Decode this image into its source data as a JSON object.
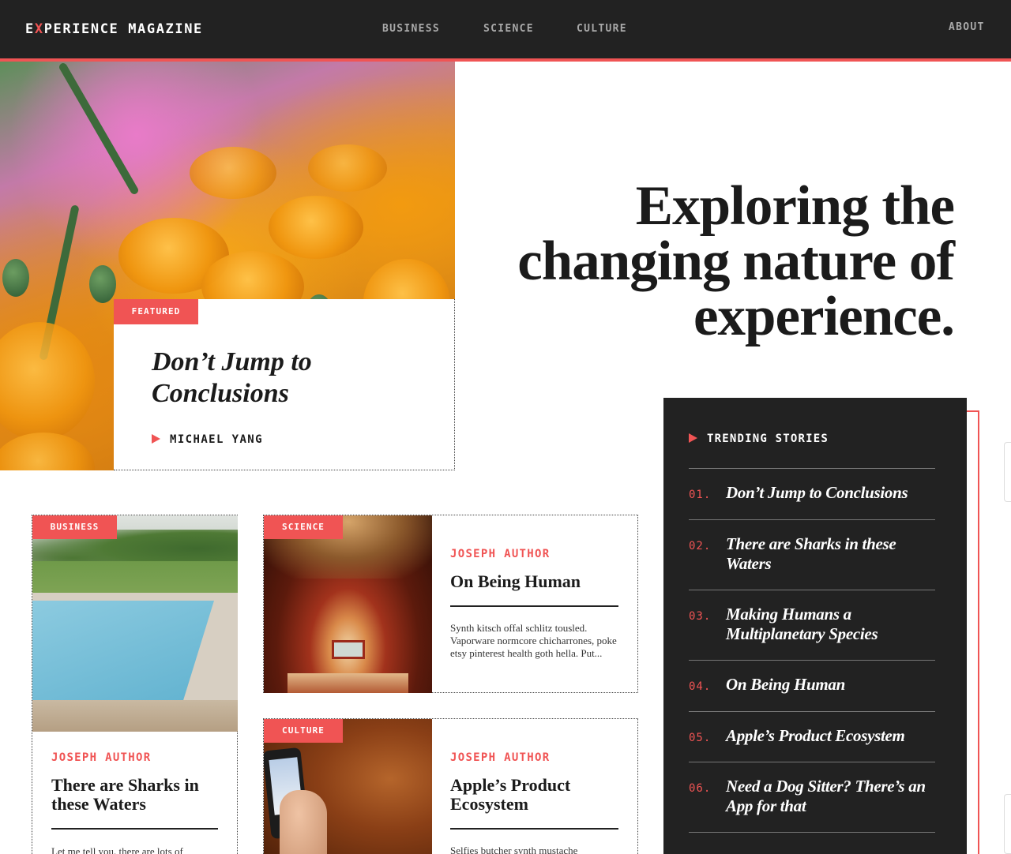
{
  "header": {
    "logo_e": "E",
    "logo_x": "X",
    "logo_rest": "PERIENCE MAGAZINE",
    "nav": [
      "BUSINESS",
      "SCIENCE",
      "CULTURE"
    ],
    "about": "ABOUT"
  },
  "hero": {
    "headline": "Exploring the changing nature of experience.",
    "featured": {
      "tag": "FEATURED",
      "title": "Don’t Jump to Conclusions",
      "author": "MICHAEL YANG"
    }
  },
  "trending": {
    "heading": "TRENDING STORIES",
    "items": [
      {
        "num": "01.",
        "title": "Don’t Jump to Conclusions"
      },
      {
        "num": "02.",
        "title": "There are Sharks in these Waters"
      },
      {
        "num": "03.",
        "title": "Making Humans a Multiplanetary Species"
      },
      {
        "num": "04.",
        "title": "On Being Human"
      },
      {
        "num": "05.",
        "title": "Apple’s Product Ecosystem"
      },
      {
        "num": "06.",
        "title": "Need a Dog Sitter? There’s an App for that"
      }
    ]
  },
  "cards": {
    "business": {
      "tag": "BUSINESS",
      "author": "JOSEPH AUTHOR",
      "title": "There are Sharks in these Waters",
      "excerpt": "Let me tell you, there are lots of"
    },
    "science": {
      "tag": "SCIENCE",
      "author": "JOSEPH AUTHOR",
      "title": "On Being Human",
      "excerpt": "Synth kitsch offal schlitz tousled. Vaporware normcore chicharrones, poke etsy pinterest health goth hella. Put..."
    },
    "culture": {
      "tag": "CULTURE",
      "author": "JOSEPH AUTHOR",
      "title": "Apple’s Product Ecosystem",
      "excerpt": "Selfies butcher synth mustache"
    }
  },
  "colors": {
    "accent": "#f05454",
    "dark": "#222222"
  },
  "icons": {
    "byline_arrow": "play-arrow-icon"
  }
}
